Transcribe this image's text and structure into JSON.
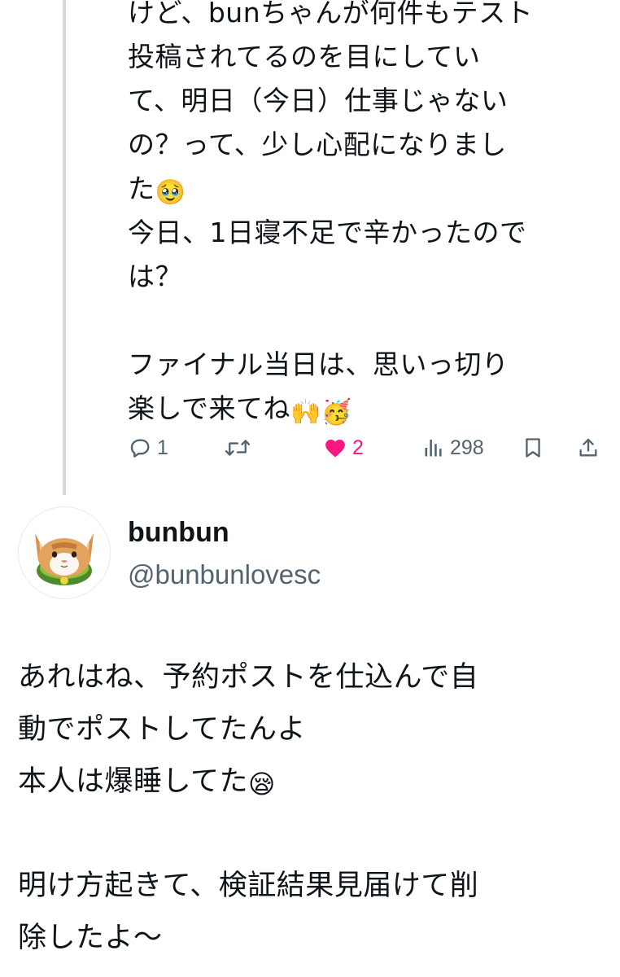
{
  "parent_post": {
    "lines": [
      "けど、bunちゃんが何件もテスト",
      "投稿されてるのを目にしてい",
      "て、明日（今日）仕事じゃない",
      "の？って、少し心配になりまし",
      "た",
      "今日、1日寝不足で辛かったので",
      "は？",
      "",
      "ファイナル当日は、思いっ切り",
      "楽しで来てね"
    ],
    "emojis": {
      "line5": "🥹",
      "line10_a": "🙌",
      "line10_b": "🥳"
    },
    "actions": {
      "reply_count": "1",
      "repost_count": "",
      "like_count": "2",
      "views_count": "298"
    },
    "icons": [
      "reply-icon",
      "repost-icon",
      "heart-icon",
      "views-icon",
      "bookmark-icon",
      "share-icon"
    ],
    "colors": {
      "like": "#f91880",
      "action_gray": "#536471",
      "thread_line": "#cfd9de"
    }
  },
  "reply_post": {
    "author": {
      "display_name": "bunbun",
      "handle": "@bunbunlovesc"
    },
    "lines": [
      "あれはね、予約ポストを仕込んで自",
      "動でポストしてたんよ",
      "本人は爆睡してた",
      "",
      "明け方起きて、検証結果見届けて削",
      "除したよ〜"
    ],
    "emojis": {
      "line3": "😪"
    }
  }
}
